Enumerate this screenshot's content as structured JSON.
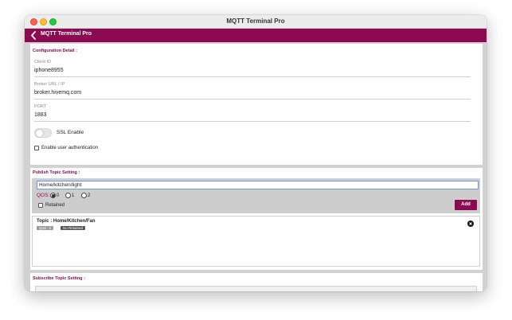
{
  "window": {
    "title": "MQTT Terminal Pro"
  },
  "navbar": {
    "title": "MQTT Terminal Pro",
    "back_icon": "chevron-left-icon"
  },
  "colors": {
    "accent": "#8b0a52",
    "input_focus": "#6d98e0"
  },
  "configuration": {
    "section_title": "Configuration Detail :",
    "client_id": {
      "label": "Client ID",
      "value": "iphone8955"
    },
    "broker": {
      "label": "Broker URL / IP",
      "value": "broker.hivemq.com"
    },
    "port": {
      "label": "PORT",
      "value": "1883"
    },
    "ssl": {
      "label": "SSL Enable",
      "enabled": false
    },
    "auth": {
      "label": "Enable user authentication",
      "checked": false
    }
  },
  "publish": {
    "section_title": "Publish Topic Setting :",
    "topic_value": "Home/kitchen/light",
    "qos_label": "QOS:",
    "qos_options": [
      "0",
      "1",
      "2"
    ],
    "qos_selected": "0",
    "retained_label": "Retained",
    "retained_checked": false,
    "add_label": "Add",
    "topics": [
      {
        "topic": "Topic : Home/Kitchen/Fan",
        "qos": "QoS : 0",
        "retained": "No Retained",
        "remove_icon": "close-circle-icon"
      }
    ]
  },
  "subscribe": {
    "section_title": "Subscribe Topic Setting :"
  }
}
